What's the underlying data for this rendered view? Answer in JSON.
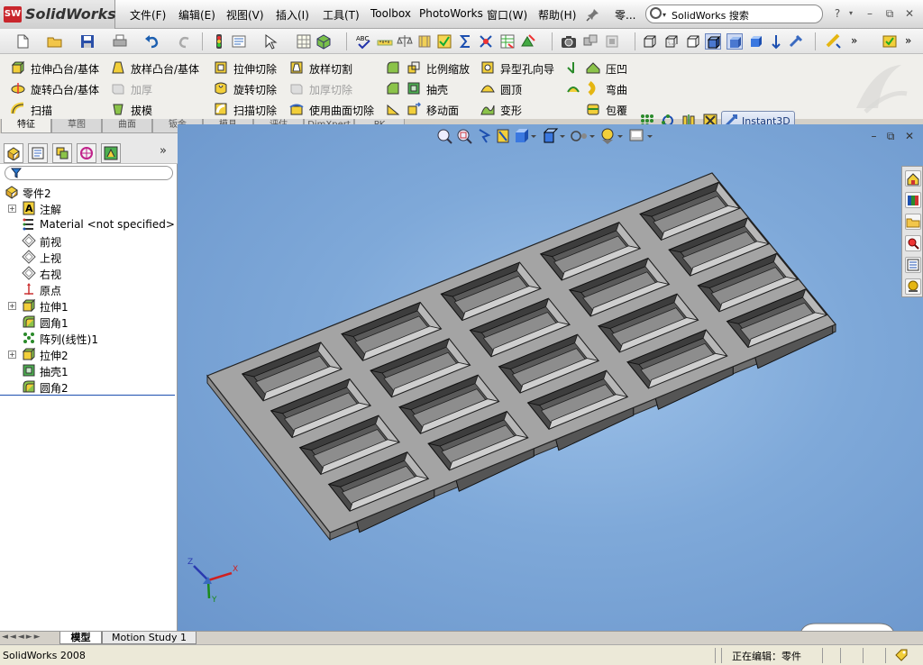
{
  "app": {
    "logo_text": "SolidWorks",
    "ds_mark": "SW",
    "doc_short": "零...",
    "search_placeholder": "SolidWorks 搜索",
    "help_glyph": "?",
    "min_glyph": "–",
    "restore_glyph": "⧉",
    "close_glyph": "✕"
  },
  "menu": {
    "items": [
      "文件(F)",
      "编辑(E)",
      "视图(V)",
      "插入(I)",
      "工具(T)",
      "Toolbox",
      "PhotoWorks",
      "窗口(W)",
      "帮助(H)"
    ]
  },
  "commands": {
    "col1": [
      "拉伸凸台/基体",
      "旋转凸台/基体",
      "扫描"
    ],
    "col2": [
      "放样凸台/基体",
      "加厚",
      "拔模"
    ],
    "col3": [
      "拉伸切除",
      "旋转切除",
      "扫描切除"
    ],
    "col4": [
      "放样切割",
      "加厚切除",
      "使用曲面切除"
    ],
    "col5": [
      "比例缩放",
      "抽壳",
      "移动面"
    ],
    "col6": [
      "异型孔向导",
      "圆顶",
      "变形"
    ],
    "col7": [
      "压凹",
      "弯曲",
      "包覆"
    ],
    "instant3d": "Instant3D"
  },
  "cm_tabs": [
    "特征",
    "草图",
    "曲面",
    "钣金",
    "模具",
    "评估",
    "DimXpert",
    "PK"
  ],
  "tree": {
    "root": "零件2",
    "items": [
      {
        "label": "注解",
        "icon": "annotation-icon",
        "expand": "+"
      },
      {
        "label": "Material <not specified>",
        "icon": "material-icon",
        "expand": ""
      },
      {
        "label": "前视",
        "icon": "plane-icon",
        "expand": ""
      },
      {
        "label": "上视",
        "icon": "plane-icon",
        "expand": ""
      },
      {
        "label": "右视",
        "icon": "plane-icon",
        "expand": ""
      },
      {
        "label": "原点",
        "icon": "origin-icon",
        "expand": ""
      },
      {
        "label": "拉伸1",
        "icon": "extrude-icon",
        "expand": "+"
      },
      {
        "label": "圆角1",
        "icon": "fillet-icon",
        "expand": ""
      },
      {
        "label": "阵列(线性)1",
        "icon": "pattern-icon",
        "expand": ""
      },
      {
        "label": "拉伸2",
        "icon": "extrude-icon",
        "expand": "+"
      },
      {
        "label": "抽壳1",
        "icon": "shell-icon",
        "expand": ""
      },
      {
        "label": "圆角2",
        "icon": "fillet-icon",
        "expand": ""
      }
    ],
    "more_glyph": "»"
  },
  "viewport": {
    "background_top": "#9ec2e9",
    "background_edge": "#6b96cc",
    "part_color": "#a4a4a4",
    "triad": {
      "x": "X",
      "y": "Y",
      "z": "Z"
    }
  },
  "bottom_tabs": [
    "模型",
    "Motion Study 1"
  ],
  "status": {
    "left": "SolidWorks 2008",
    "right": "正在编辑：零件"
  }
}
